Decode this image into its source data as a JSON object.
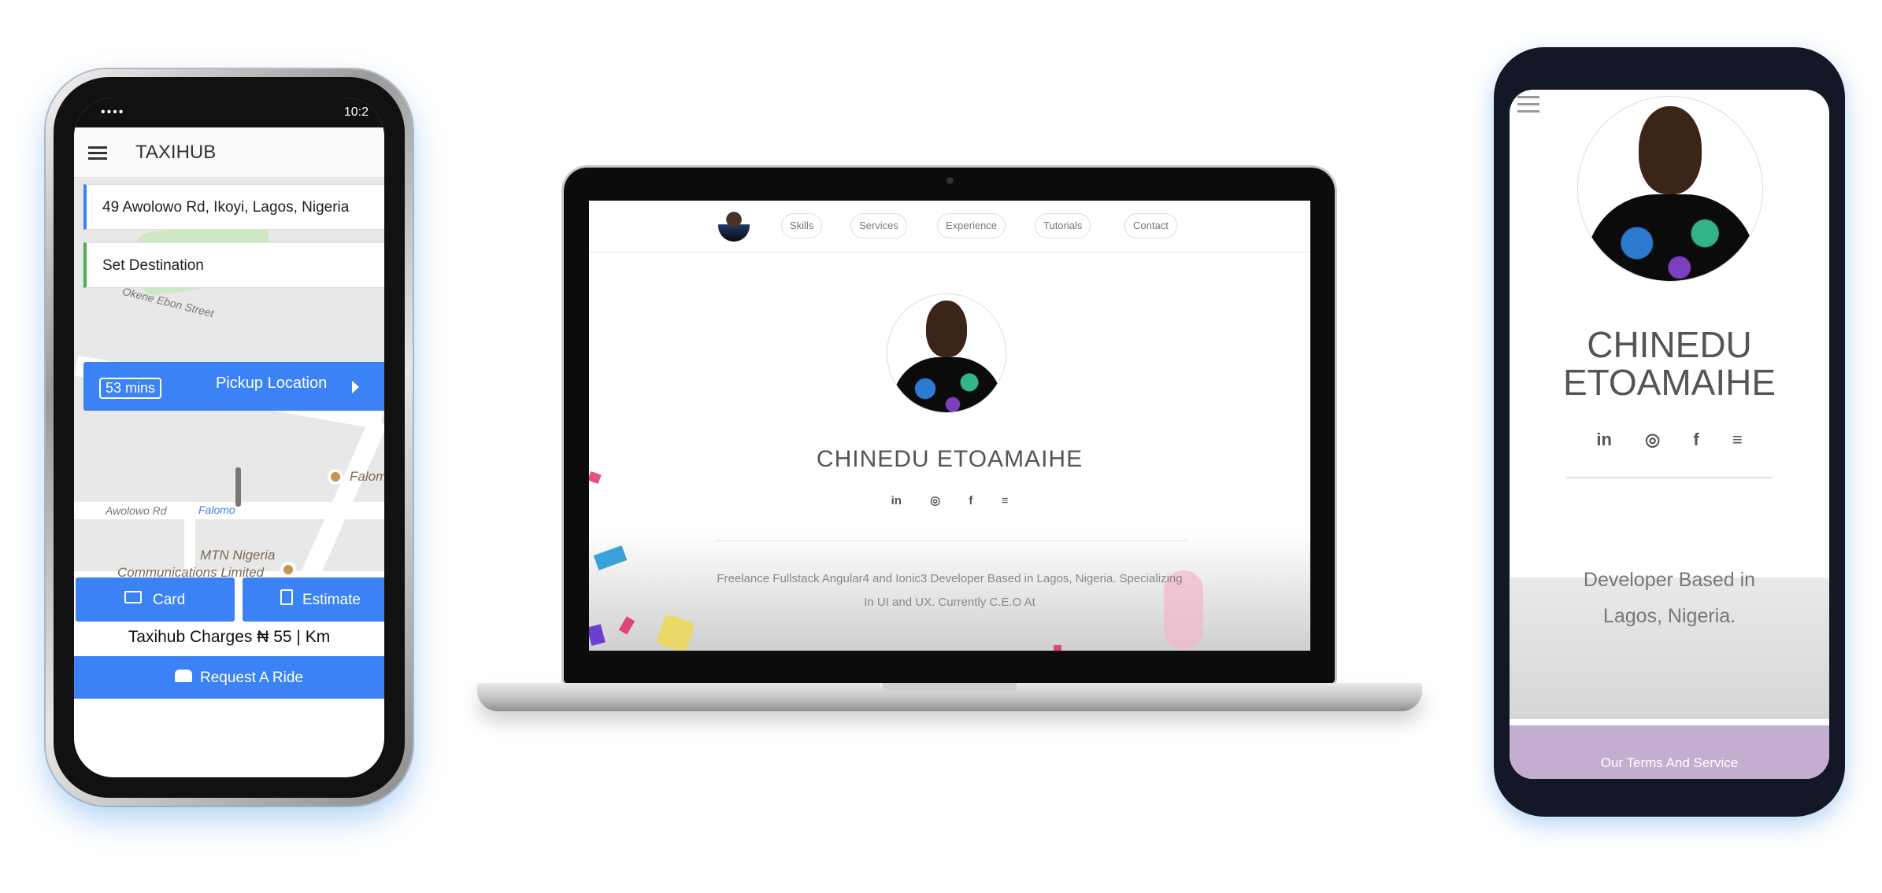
{
  "taxihub": {
    "status": {
      "signal": "••••",
      "time": "10:2"
    },
    "app_title": "TAXIHUB",
    "pickup_address": "49 Awolowo Rd, Ikoyi, Lagos, Nigeria",
    "destination_placeholder": "Set Destination",
    "eta": "53 mins",
    "pickup_label": "Pickup Location",
    "map_labels": {
      "street1": "Okene Ebon Street",
      "street2": "Awolowo Rd",
      "place1": "Falomo",
      "poi1": "Falom",
      "poi2_line1": "MTN Nigeria",
      "poi2_line2": "Communications Limited"
    },
    "card_button": "Card",
    "estimate_button": "Estimate",
    "charges": "Taxihub Charges ₦ 55 | Km",
    "request_button": "Request A Ride"
  },
  "laptop_site": {
    "nav": [
      "Skills",
      "Services",
      "Experience",
      "Tutorials",
      "Contact"
    ],
    "name": "CHINEDU ETOAMAIHE",
    "social_icons": [
      "linkedin-icon",
      "github-icon",
      "facebook-icon",
      "stackoverflow-icon"
    ],
    "social_glyphs": [
      "in",
      "◎",
      "f",
      "≡"
    ],
    "bio_line1": "Freelance Fullstack Angular4 and Ionic3 Developer Based in Lagos, Nigeria. Specializing",
    "bio_line2": "In UI and UX. Currently C.E.O At"
  },
  "mobile_site": {
    "name_line1": "CHINEDU",
    "name_line2": "ETOAMAIHE",
    "social_glyphs": [
      "in",
      "◎",
      "f",
      "≡"
    ],
    "bio_line1": "Developer Based in",
    "bio_line2": "Lagos, Nigeria.",
    "terms": "Our Terms And Service"
  },
  "colors": {
    "primary_blue": "#3b82f6",
    "footer_purple": "#c4aed0"
  }
}
